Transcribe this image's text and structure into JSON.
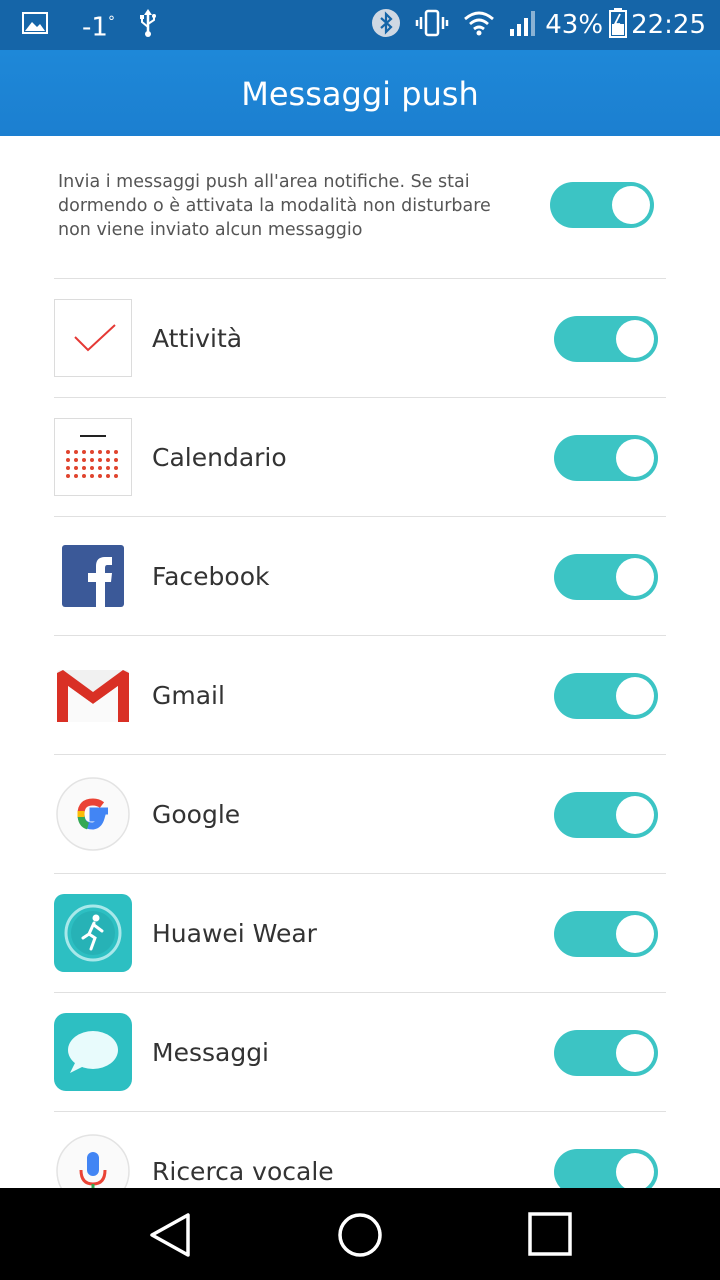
{
  "status_bar": {
    "temperature": "-1",
    "degree": "°",
    "battery": "43%",
    "time": "22:25"
  },
  "header": {
    "title": "Messaggi push"
  },
  "intro": {
    "text": "Invia i messaggi push all'area notifiche. Se stai dormendo o è attivata la modalità non disturbare non viene inviato alcun messaggio",
    "enabled": true
  },
  "apps": [
    {
      "label": "Attività",
      "icon": "activity-check-icon",
      "enabled": true
    },
    {
      "label": "Calendario",
      "icon": "calendar-icon",
      "enabled": true
    },
    {
      "label": "Facebook",
      "icon": "facebook-icon",
      "enabled": true
    },
    {
      "label": "Gmail",
      "icon": "gmail-icon",
      "enabled": true
    },
    {
      "label": "Google",
      "icon": "google-icon",
      "enabled": true
    },
    {
      "label": "Huawei Wear",
      "icon": "huawei-wear-icon",
      "enabled": true
    },
    {
      "label": "Messaggi",
      "icon": "messages-icon",
      "enabled": true
    },
    {
      "label": "Ricerca vocale",
      "icon": "voice-search-icon",
      "enabled": true
    }
  ],
  "colors": {
    "status_bar": "#1565a8",
    "app_bar": "#1e88d8",
    "toggle_on": "#3cc4c4"
  }
}
